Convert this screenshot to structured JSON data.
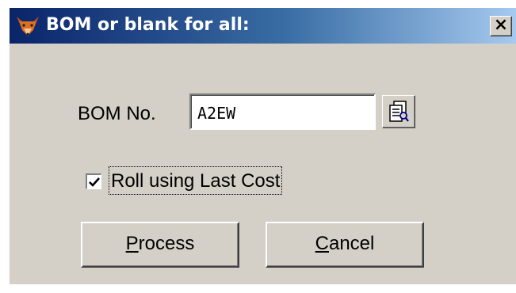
{
  "window": {
    "title": "BOM or blank for all:",
    "icon": "fox-app-icon",
    "close_label": "×"
  },
  "form": {
    "bom_label": "BOM No.",
    "bom_value": "A2EW",
    "lookup_icon": "lookup-list-icon",
    "roll_checkbox_label": "Roll using Last Cost",
    "roll_checked": true
  },
  "buttons": {
    "process": {
      "mnemonic": "P",
      "rest": "rocess"
    },
    "cancel": {
      "mnemonic": "C",
      "rest": "ancel"
    }
  },
  "colors": {
    "dialog_face": "#d4d0c8",
    "title_gradient_start": "#0a246a",
    "title_gradient_end": "#a6caf0",
    "title_text": "#ffffff"
  }
}
